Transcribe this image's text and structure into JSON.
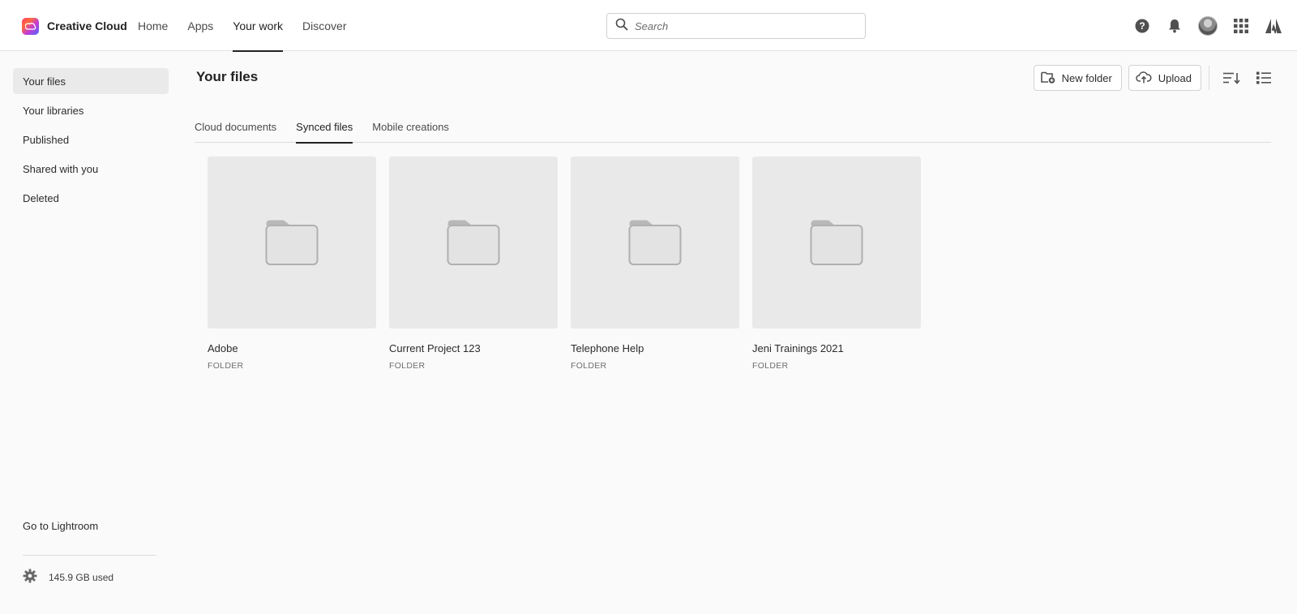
{
  "brand": {
    "name": "Creative Cloud"
  },
  "nav": [
    {
      "label": "Home",
      "active": false
    },
    {
      "label": "Apps",
      "active": false
    },
    {
      "label": "Your work",
      "active": true
    },
    {
      "label": "Discover",
      "active": false
    }
  ],
  "search": {
    "placeholder": "Search",
    "value": ""
  },
  "top_icons": [
    "help-icon",
    "bell-icon",
    "avatar",
    "apps-grid-icon",
    "adobe-logo-icon"
  ],
  "sidebar": {
    "items": [
      {
        "label": "Your files",
        "active": true
      },
      {
        "label": "Your libraries",
        "active": false
      },
      {
        "label": "Published",
        "active": false
      },
      {
        "label": "Shared with you",
        "active": false
      },
      {
        "label": "Deleted",
        "active": false
      }
    ],
    "bottom_link": "Go to Lightroom",
    "storage": "145.9 GB used"
  },
  "main": {
    "title": "Your files",
    "toolbar": {
      "new_folder": "New folder",
      "upload": "Upload"
    },
    "tabs": [
      {
        "label": "Cloud documents",
        "active": false
      },
      {
        "label": "Synced files",
        "active": true
      },
      {
        "label": "Mobile creations",
        "active": false
      }
    ],
    "items": [
      {
        "name": "Adobe",
        "type": "FOLDER"
      },
      {
        "name": "Current Project 123",
        "type": "FOLDER"
      },
      {
        "name": "Telephone Help",
        "type": "FOLDER"
      },
      {
        "name": "Jeni Trainings 2021",
        "type": "FOLDER"
      }
    ]
  },
  "colors": {
    "accent": "#222222",
    "thumb_bg": "#e9e9e9",
    "folder_icon": "#b8b8b8"
  }
}
